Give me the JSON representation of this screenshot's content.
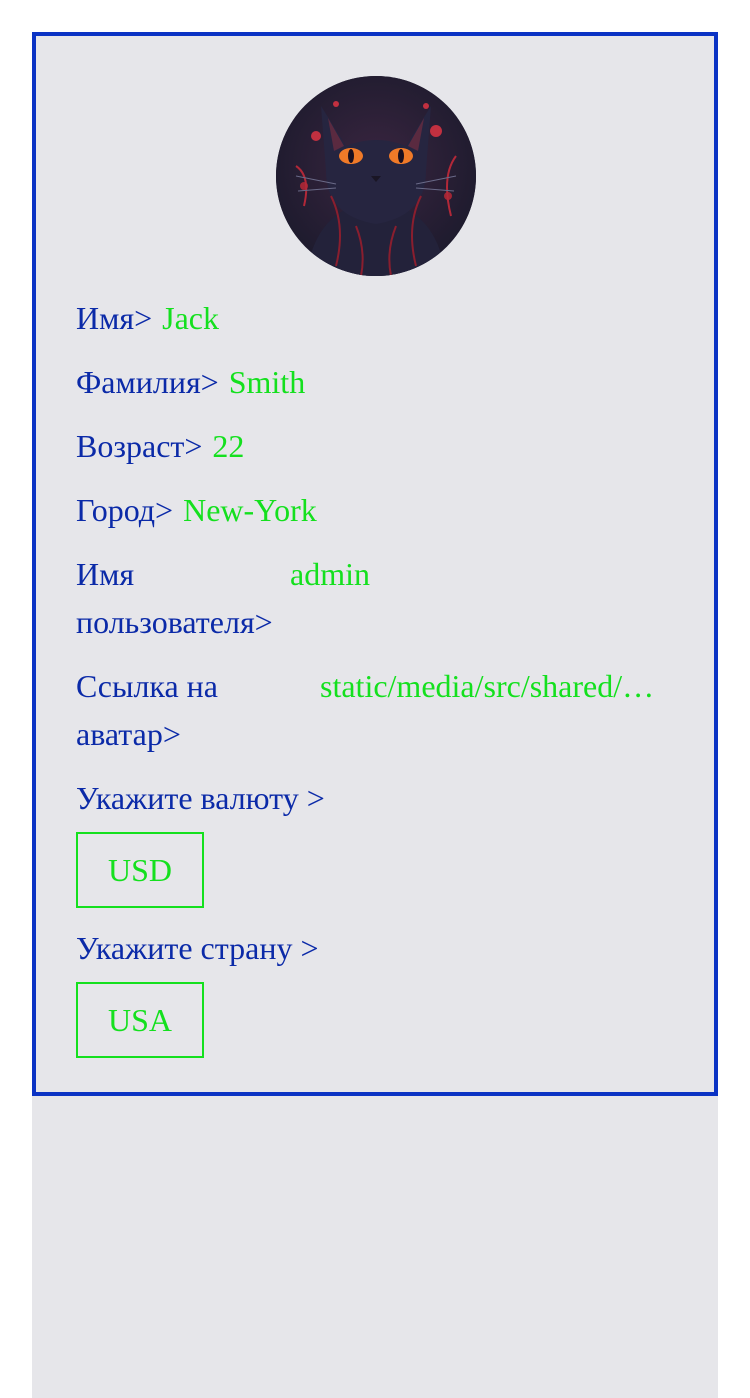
{
  "profile": {
    "avatar_alt": "avatar",
    "fields": {
      "first_name": {
        "label": "Имя>",
        "value": "Jack"
      },
      "last_name": {
        "label": "Фамилия>",
        "value": "Smith"
      },
      "age": {
        "label": "Возраст>",
        "value": "22"
      },
      "city": {
        "label": "Город>",
        "value": "New-York"
      },
      "username": {
        "label": "Имя пользователя>",
        "value": "admin"
      },
      "avatar_link": {
        "label": "Ссылка на аватар>",
        "value": "static/media/src/shared/a…"
      }
    },
    "currency": {
      "label": "Укажите валюту >",
      "value": "USD"
    },
    "country": {
      "label": "Укажите страну >",
      "value": "USA"
    }
  },
  "colors": {
    "border": "#0b33c4",
    "label": "#0b2aa8",
    "value": "#14e01e",
    "card_bg": "#e6e6ea"
  }
}
